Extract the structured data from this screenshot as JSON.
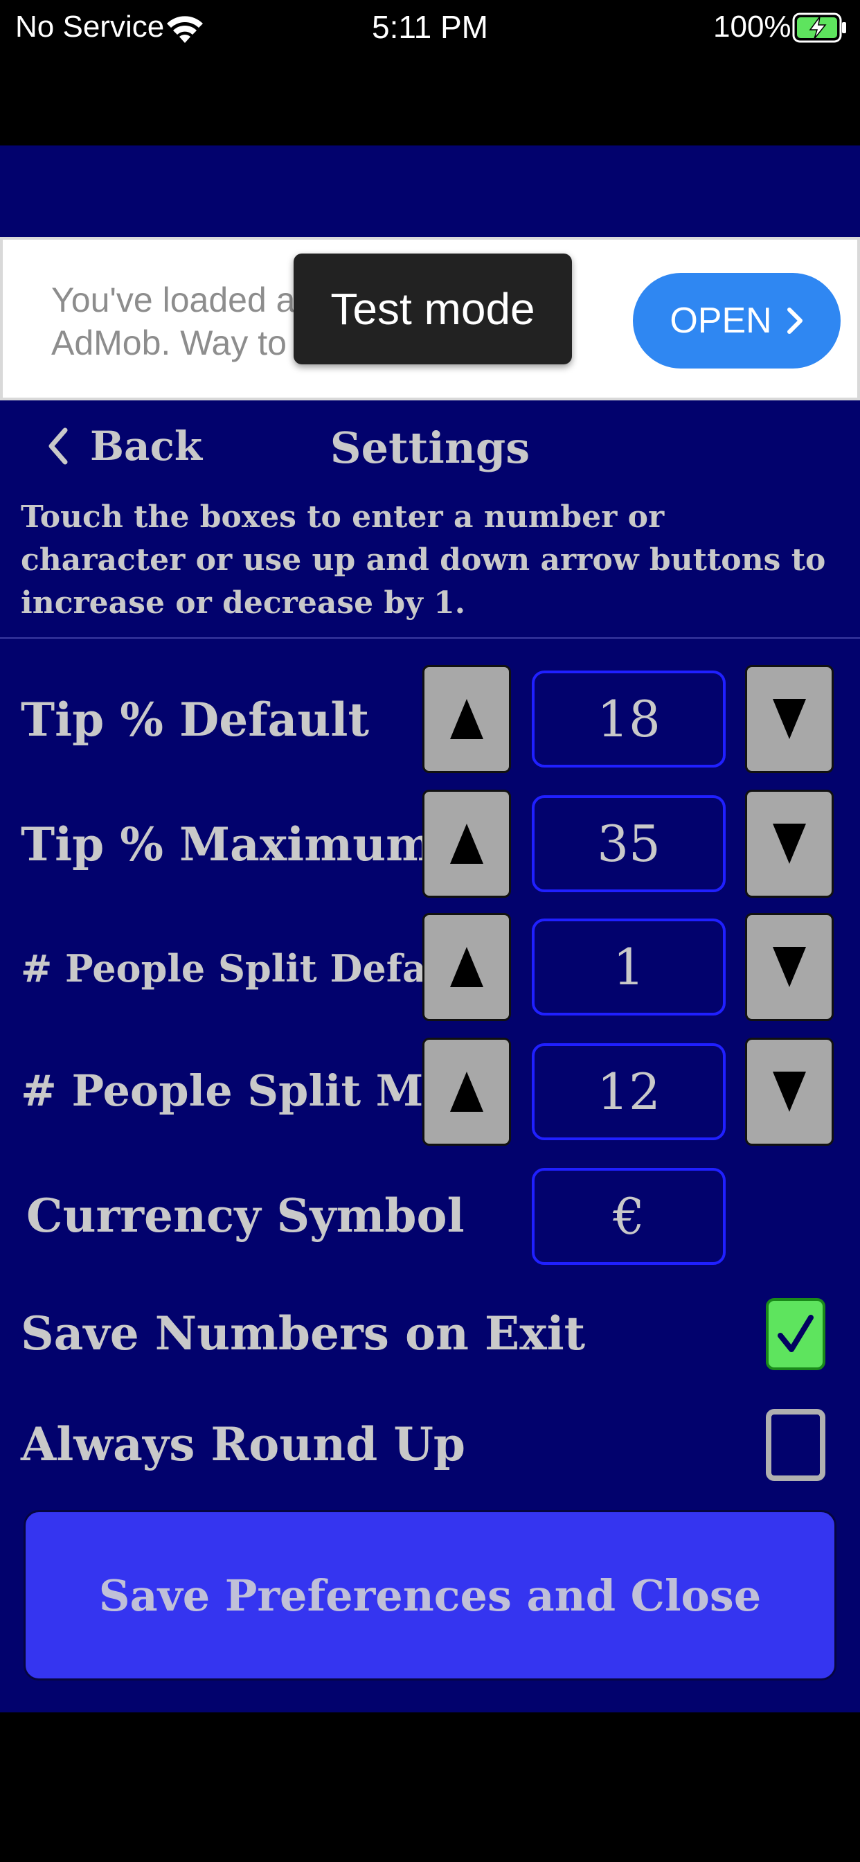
{
  "status_bar": {
    "carrier": "No Service",
    "time": "5:11 PM",
    "battery_pct": "100%"
  },
  "ad": {
    "line1": "You've loaded a",
    "line2": "AdMob. Way to g",
    "toast": "Test mode",
    "open_label": "OPEN"
  },
  "header": {
    "back_label": "Back",
    "title": "Settings"
  },
  "instructions": "Touch the boxes to enter a number or character or use up and down arrow buttons to increase or decrease by 1.",
  "rows": [
    {
      "label": "Tip % Default",
      "value": "18"
    },
    {
      "label": "Tip % Maximum",
      "value": "35"
    },
    {
      "label": "# People Split Default",
      "value": "1"
    },
    {
      "label": "# People Split Max",
      "value": "12"
    }
  ],
  "currency": {
    "label": "Currency Symbol",
    "value": "€"
  },
  "toggles": [
    {
      "label": "Save Numbers on Exit",
      "checked": true
    },
    {
      "label": "Always Round Up",
      "checked": false
    }
  ],
  "save_button": "Save Preferences and Close",
  "colors": {
    "panel": "#02026d",
    "button": "#3535f0",
    "check_on": "#5ee45e",
    "ad_open": "#2f87f2"
  }
}
